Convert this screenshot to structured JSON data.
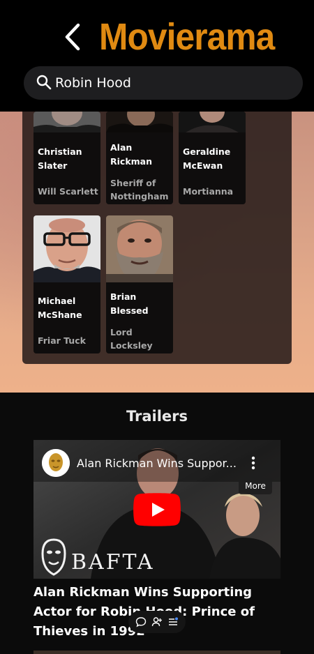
{
  "header": {
    "brand": "Movierama",
    "back_icon": "chevron-left-icon",
    "brand_color": "#e08a12"
  },
  "search": {
    "value": "Robin Hood",
    "icon": "search-icon"
  },
  "cast": [
    {
      "name": "Christian Slater",
      "role": "Will Scarlett"
    },
    {
      "name": "Alan Rickman",
      "role": "Sheriff of Nottingham"
    },
    {
      "name": "Geraldine McEwan",
      "role": "Mortianna"
    },
    {
      "name": "Michael McShane",
      "role": "Friar Tuck"
    },
    {
      "name": "Brian Blessed",
      "role": "Lord Locksley"
    }
  ],
  "trailers": {
    "title": "Trailers",
    "video": {
      "title": "Alan Rickman Wins Suppor...",
      "more_label": "More",
      "overlay_brand": "BAFTA"
    },
    "caption": "Alan Rickman Wins Supporting Actor for Robin Hood: Prince of Thieves in 1992"
  },
  "floating_toolbar": {
    "icons": [
      "comment-icon",
      "add-person-icon",
      "menu-list-icon"
    ]
  }
}
